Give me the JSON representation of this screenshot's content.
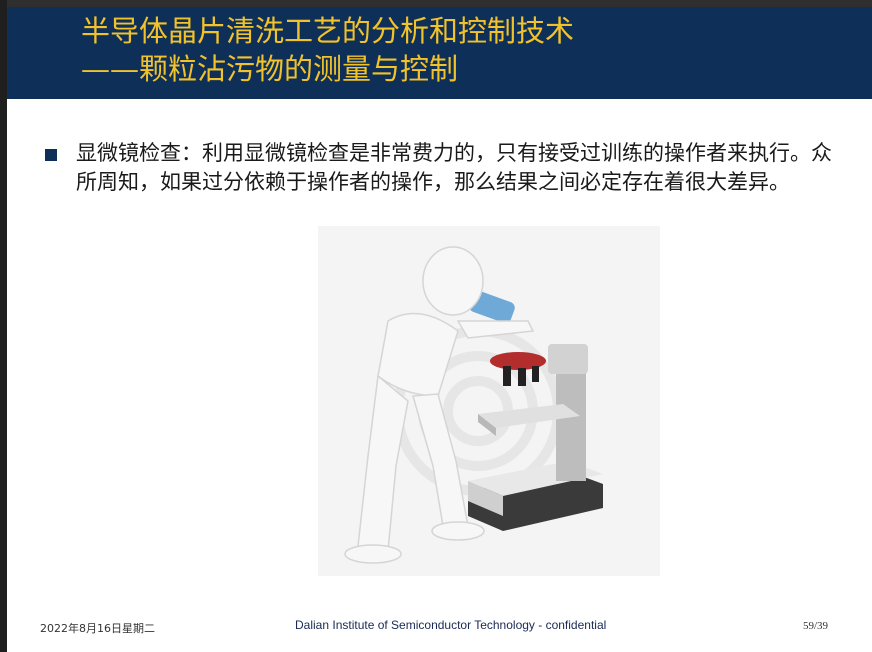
{
  "slide": {
    "title_line1": "半导体晶片清洗工艺的分析和控制技术",
    "title_line2": "——颗粒沾污物的测量与控制",
    "bullet_text": "显微镜检查：利用显微镜检查是非常费力的，只有接受过训练的操作者来执行。众所周知，如果过分依赖于操作者的操作，那么结果之间必定存在着很大差异。",
    "image": "person-using-microscope-illustration"
  },
  "footer": {
    "date": "2022年8月16日星期二",
    "center": "Dalian Institute of Semiconductor Technology - confidential",
    "page": "59/39"
  },
  "colors": {
    "header_bg": "#0e2f57",
    "title_color": "#f2c22b",
    "bullet_color": "#0e2f57"
  }
}
